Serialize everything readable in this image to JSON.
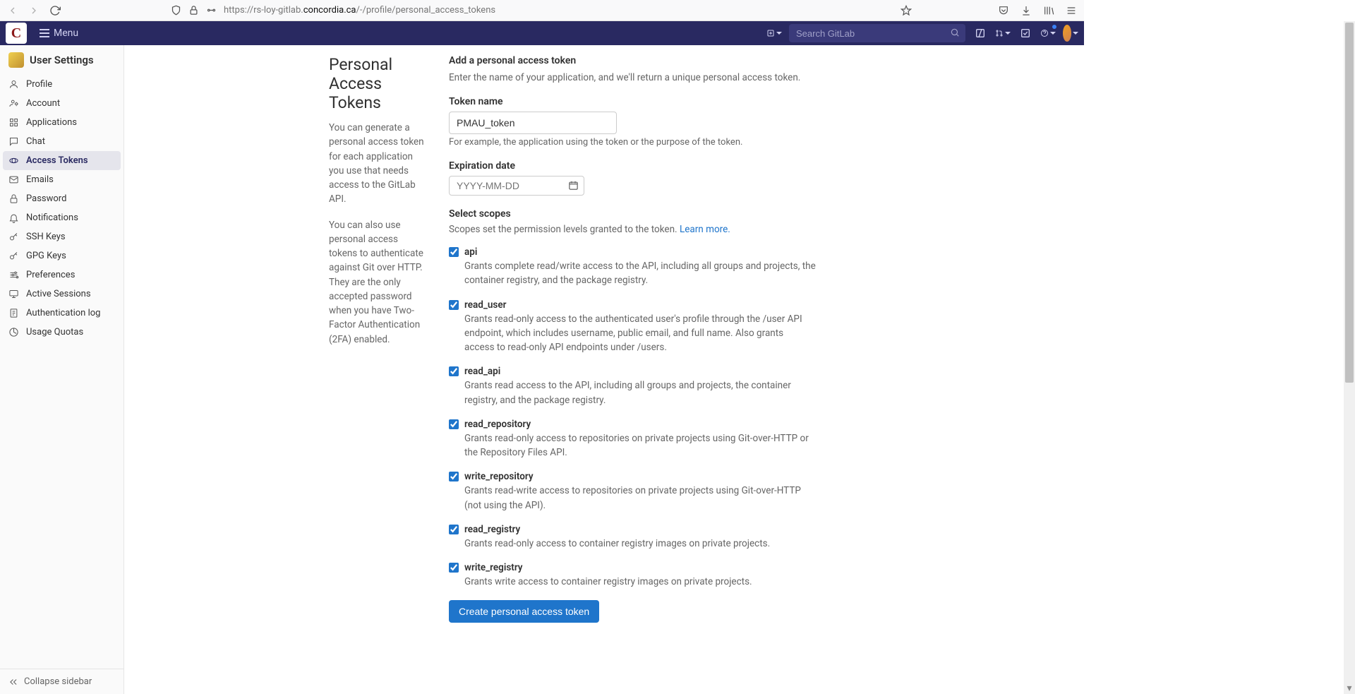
{
  "browser": {
    "url_prefix": "https://rs-loy-gitlab.",
    "url_domain": "concordia.ca",
    "url_suffix": "/-/profile/personal_access_tokens"
  },
  "header": {
    "menu_label": "Menu",
    "search_placeholder": "Search GitLab"
  },
  "sidebar": {
    "title": "User Settings",
    "items": [
      {
        "label": "Profile",
        "icon": "profile-icon"
      },
      {
        "label": "Account",
        "icon": "account-icon"
      },
      {
        "label": "Applications",
        "icon": "applications-icon"
      },
      {
        "label": "Chat",
        "icon": "chat-icon"
      },
      {
        "label": "Access Tokens",
        "icon": "token-icon",
        "active": true
      },
      {
        "label": "Emails",
        "icon": "email-icon"
      },
      {
        "label": "Password",
        "icon": "lock-icon"
      },
      {
        "label": "Notifications",
        "icon": "bell-icon"
      },
      {
        "label": "SSH Keys",
        "icon": "key-icon"
      },
      {
        "label": "GPG Keys",
        "icon": "key-icon"
      },
      {
        "label": "Preferences",
        "icon": "preferences-icon"
      },
      {
        "label": "Active Sessions",
        "icon": "sessions-icon"
      },
      {
        "label": "Authentication log",
        "icon": "log-icon"
      },
      {
        "label": "Usage Quotas",
        "icon": "quota-icon"
      }
    ],
    "collapse_label": "Collapse sidebar"
  },
  "left_panel": {
    "heading": "Personal Access Tokens",
    "para1": "You can generate a personal access token for each application you use that needs access to the GitLab API.",
    "para2": "You can also use personal access tokens to authenticate against Git over HTTP. They are the only accepted password when you have Two-Factor Authentication (2FA) enabled."
  },
  "form": {
    "title": "Add a personal access token",
    "intro": "Enter the name of your application, and we'll return a unique personal access token.",
    "token_name_label": "Token name",
    "token_name_value": "PMAU_token",
    "token_name_hint": "For example, the application using the token or the purpose of the token.",
    "expiration_label": "Expiration date",
    "expiration_placeholder": "YYYY-MM-DD",
    "scopes_label": "Select scopes",
    "scopes_intro": "Scopes set the permission levels granted to the token. ",
    "scopes_link": "Learn more.",
    "submit_label": "Create personal access token"
  },
  "scopes": [
    {
      "name": "api",
      "checked": true,
      "desc": "Grants complete read/write access to the API, including all groups and projects, the container registry, and the package registry."
    },
    {
      "name": "read_user",
      "checked": true,
      "desc": "Grants read-only access to the authenticated user's profile through the /user API endpoint, which includes username, public email, and full name. Also grants access to read-only API endpoints under /users."
    },
    {
      "name": "read_api",
      "checked": true,
      "desc": "Grants read access to the API, including all groups and projects, the container registry, and the package registry."
    },
    {
      "name": "read_repository",
      "checked": true,
      "desc": "Grants read-only access to repositories on private projects using Git-over-HTTP or the Repository Files API."
    },
    {
      "name": "write_repository",
      "checked": true,
      "desc": "Grants read-write access to repositories on private projects using Git-over-HTTP (not using the API)."
    },
    {
      "name": "read_registry",
      "checked": true,
      "desc": "Grants read-only access to container registry images on private projects."
    },
    {
      "name": "write_registry",
      "checked": true,
      "desc": "Grants write access to container registry images on private projects."
    }
  ]
}
